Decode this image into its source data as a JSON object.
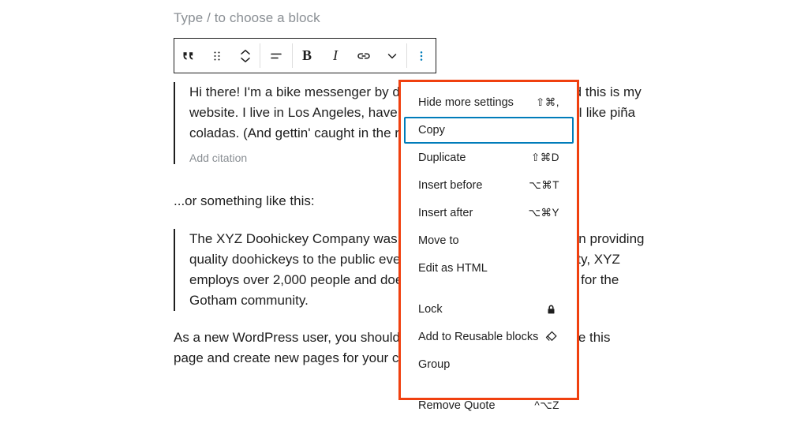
{
  "editor": {
    "placeholder": "Type / to choose a block",
    "blocks": [
      {
        "type": "quote",
        "text": "Hi there! I'm a bike messenger by day, aspiring actor by night, and this is my website. I live in Los Angeles, have a great dog named Jack, and I like piña coladas. (And gettin' caught in the rain.)",
        "citation_placeholder": "Add citation"
      },
      {
        "type": "paragraph",
        "text": "...or something like this:"
      },
      {
        "type": "quote",
        "text": "The XYZ Doohickey Company was founded in 1971, and has been providing quality doohickeys to the public ever since. Located in Gotham City, XYZ employs over 2,000 people and does all kinds of awesome things for the Gotham community."
      },
      {
        "type": "paragraph",
        "text": "As a new WordPress user, you should go to your dashboard to delete this page and create new pages for your content."
      }
    ]
  },
  "toolbar": {
    "items": [
      {
        "name": "block-type-quote-icon",
        "label": "Quote",
        "icon": "quote-icon"
      },
      {
        "name": "drag-handle",
        "label": "Drag",
        "icon": "drag-handle-icon"
      },
      {
        "name": "move-up-down",
        "label": "Move up or down",
        "icon": "chevron-up-down-icon"
      },
      {
        "name": "align-text",
        "label": "Change alignment",
        "icon": "align-icon"
      },
      {
        "name": "bold",
        "label": "B",
        "icon": "bold-icon"
      },
      {
        "name": "italic",
        "label": "I",
        "icon": "italic-icon"
      },
      {
        "name": "link",
        "label": "Link",
        "icon": "link-icon"
      },
      {
        "name": "more-rich-text",
        "label": "More",
        "icon": "chevron-down-icon"
      },
      {
        "name": "block-options",
        "label": "Options",
        "icon": "three-dots-vertical-icon"
      }
    ],
    "active_item": "block-options",
    "active_color": "#007cba"
  },
  "menu": {
    "highlight_color": "#f0400f",
    "focus_color": "#007cba",
    "focused_item": "Copy",
    "sections": [
      {
        "items": [
          {
            "label": "Hide more settings",
            "shortcut": "⇧⌘,",
            "icon": null,
            "focused": false
          },
          {
            "label": "Copy",
            "shortcut": "",
            "icon": null,
            "focused": true
          },
          {
            "label": "Duplicate",
            "shortcut": "⇧⌘D",
            "icon": null,
            "focused": false
          },
          {
            "label": "Insert before",
            "shortcut": "⌥⌘T",
            "icon": null,
            "focused": false
          },
          {
            "label": "Insert after",
            "shortcut": "⌥⌘Y",
            "icon": null,
            "focused": false
          },
          {
            "label": "Move to",
            "shortcut": "",
            "icon": null,
            "focused": false
          },
          {
            "label": "Edit as HTML",
            "shortcut": "",
            "icon": null,
            "focused": false
          }
        ]
      },
      {
        "items": [
          {
            "label": "Lock",
            "shortcut": "",
            "icon": "lock-icon",
            "focused": false
          },
          {
            "label": "Add to Reusable blocks",
            "shortcut": "",
            "icon": "reusable-block-icon",
            "focused": false
          },
          {
            "label": "Group",
            "shortcut": "",
            "icon": null,
            "focused": false
          }
        ]
      },
      {
        "items": [
          {
            "label": "Remove Quote",
            "shortcut": "^⌥Z",
            "icon": null,
            "focused": false
          }
        ]
      }
    ]
  }
}
